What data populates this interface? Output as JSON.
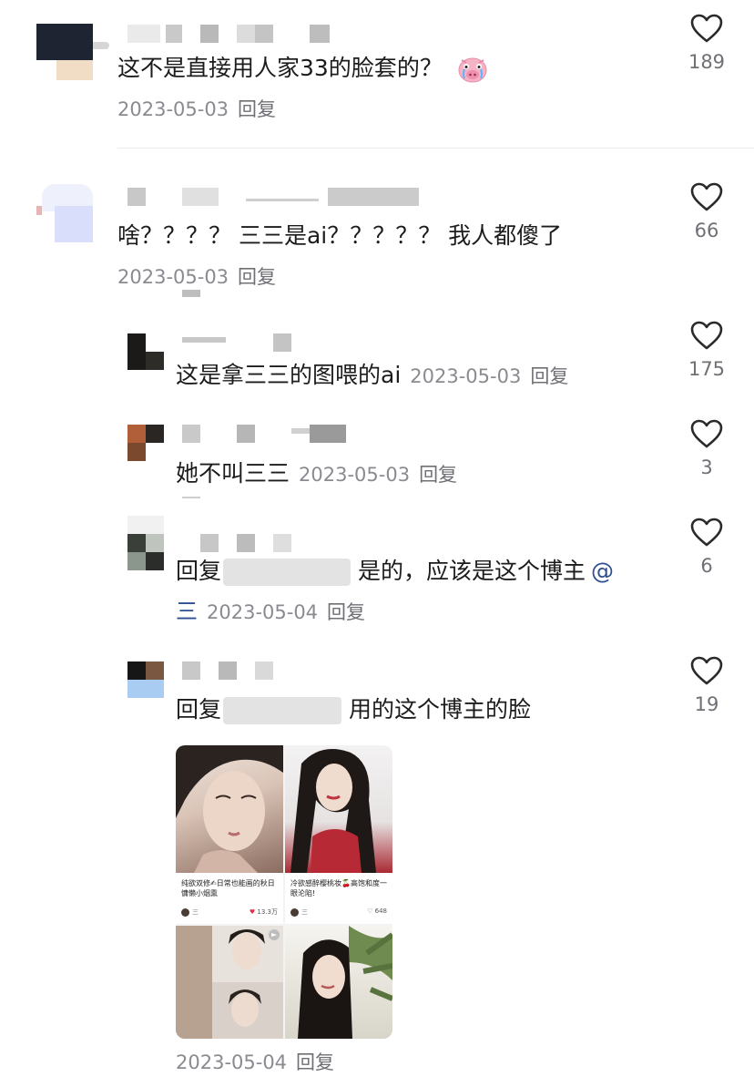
{
  "comments": [
    {
      "text": "这不是直接用人家33的脸套的？",
      "date": "2023-05-03",
      "reply": "回复",
      "likes": "189"
    },
    {
      "text": "啥？？？？ 三三是ai？？？？？ 我人都傻了",
      "date": "2023-05-03",
      "reply": "回复",
      "likes": "66"
    },
    {
      "text": "这是拿三三的图喂的ai",
      "date": "2023-05-03",
      "reply": "回复",
      "likes": "175"
    },
    {
      "text": "她不叫三三",
      "date": "2023-05-03",
      "reply": "回复",
      "likes": "3"
    },
    {
      "prefix": "回复",
      "text": "是的，应该是这个博主",
      "mention_at": "@",
      "mention_name": "三",
      "date": "2023-05-04",
      "reply": "回复",
      "likes": "6"
    },
    {
      "prefix": "回复",
      "text": "用的这个博主的脸",
      "date": "2023-05-04",
      "reply": "回复",
      "likes": "19"
    }
  ],
  "posts": [
    {
      "title": "纯欲双修✍日常也能画的秋日慵懒小烟熏",
      "author": "三",
      "likes": "13.3万"
    },
    {
      "title": "冷欲感醉樱桃妆🍒高饱和度一眼沦陷!",
      "author": "三",
      "likes": "648"
    }
  ],
  "colors": {
    "text": "#1c1c1c",
    "meta": "#8a8b91",
    "mention": "#2c4f91",
    "heart": "#2a2a2a"
  },
  "icons": {
    "like": "heart-outline-icon",
    "emoji": "crying-pig-emoji-icon"
  }
}
